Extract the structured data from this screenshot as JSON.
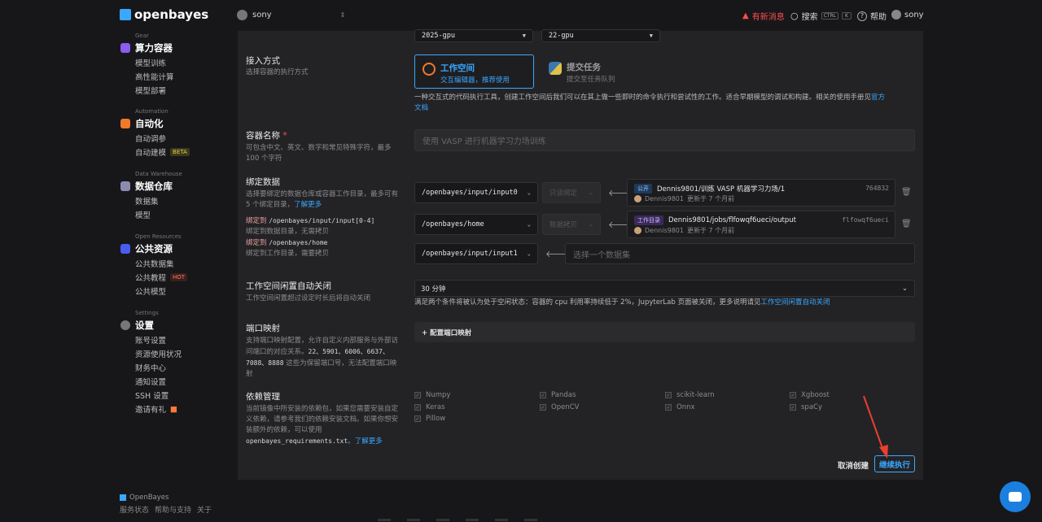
{
  "brand": {
    "name": "openbayes"
  },
  "topbar": {
    "workspace": "sony",
    "notifications": "有新消息",
    "search": "搜索",
    "shortcut_ctrl": "CTRL",
    "shortcut_k": "K",
    "help": "帮助",
    "user": "sony"
  },
  "sidebar": {
    "gear": {
      "caption": "Gear",
      "title": "算力容器",
      "items": [
        "模型训练",
        "高性能计算",
        "模型部署"
      ]
    },
    "automation": {
      "caption": "Automation",
      "title": "自动化",
      "items": [
        "自动调参",
        "自动建模"
      ],
      "beta": "BETA"
    },
    "warehouse": {
      "caption": "Data Warehouse",
      "title": "数据仓库",
      "items": [
        "数据集",
        "模型"
      ]
    },
    "open": {
      "caption": "Open Resources",
      "title": "公共资源",
      "items": [
        "公共数据集",
        "公共教程",
        "公共模型"
      ],
      "hot": "HOT"
    },
    "settings": {
      "caption": "Settings",
      "title": "设置",
      "items": [
        "账号设置",
        "资源使用状况",
        "财务中心",
        "通知设置",
        "SSH 设置",
        "邀请有礼"
      ]
    },
    "footer": {
      "brand": "OpenBayes",
      "links": [
        "服务状态",
        "帮助与支持",
        "关于"
      ]
    }
  },
  "form": {
    "top_selects": [
      "2025-gpu",
      "22-gpu"
    ],
    "access": {
      "label": "接入方式",
      "desc": "选择容器的执行方式",
      "options": [
        {
          "title": "工作空间",
          "sub": "交互编辑器，推荐使用"
        },
        {
          "title": "提交任务",
          "sub": "提交至任务队列"
        }
      ],
      "note": "一种交互式的代码执行工具，创建工作空间后我们可以在其上做一些即时的命令执行和尝试性的工作。适合早期模型的调试和构建。相关的使用手册见",
      "note_link1": "官方",
      "note_link2": "文档"
    },
    "name": {
      "label": "容器名称",
      "required": "*",
      "desc1": "可包含中文、英文、数字和常见特殊字符，最多",
      "desc2": "100 个字符",
      "placeholder": "使用 VASP 进行机器学习力场训练"
    },
    "bind": {
      "label": "绑定数据",
      "desc1": "选择要绑定的数据仓库或容器工作目录，最多可有",
      "desc2": "5 个绑定目录，",
      "learn_more": "了解更多",
      "rule1_prefix": "绑定到",
      "rule1_path": "/openbayes/input/input[0-4]",
      "rule1_desc": "绑定到数据目录，无需拷贝",
      "rule2_prefix": "绑定到",
      "rule2_path": "/openbayes/home",
      "rule2_desc": "绑定到工作目录，需要拷贝",
      "rows": [
        {
          "path": "/openbayes/input/input0",
          "mode": "只读绑定",
          "tag": "公开",
          "title": "Dennis9801/训练 VASP 机器学习力场/1",
          "owner": "Dennis9801",
          "updated": "更新于 7 个月前",
          "hash": "764832"
        },
        {
          "path": "/openbayes/home",
          "mode": "数据拷贝",
          "tag": "工作目录",
          "title": "Dennis9801/jobs/flfowqf6ueci/output",
          "owner": "Dennis9801",
          "updated": "更新于 7 个月前",
          "hash": "flfowqf6ueci"
        },
        {
          "path": "/openbayes/input/input1",
          "placeholder": "选择一个数据集"
        }
      ]
    },
    "idle": {
      "label": "工作空间闲置自动关闭",
      "desc": "工作空间闲置超过设定时长后将自动关闭",
      "value": "30 分钟",
      "note": "满足两个条件将被认为处于空闲状态：容器的 cpu 利用率持续低于 2%，JupyterLab 页面被关闭，更多说明请见",
      "note_link": "工作空间闲置自动关闭"
    },
    "ports": {
      "label": "端口映射",
      "desc1": "支持端口映射配置，允许自定义内部服务与外部访",
      "desc2": "问端口的对应关系。",
      "desc3a": "22、5901、6006、6637、",
      "desc4a": "7088、8888",
      "desc4b": " 这些为保留端口号，无法配置端口映",
      "desc5": "射",
      "button": "+ 配置端口映射"
    },
    "deps": {
      "label": "依赖管理",
      "desc1": "当前镜像中所安装的依赖包，如果您需要安装自定",
      "desc2": "义依赖，请参考我们的依赖安装文档。如果你想安",
      "desc3": "装额外的依赖，可以使用",
      "file": "openbayes_requirements.txt",
      "learn_more": "。了解更多",
      "packages": [
        "Numpy",
        "Pandas",
        "scikit-learn",
        "Xgboost",
        "Keras",
        "OpenCV",
        "Onnx",
        "spaCy",
        "Pillow"
      ]
    },
    "actions": {
      "cancel": "取消创建",
      "continue": "继续执行"
    }
  }
}
